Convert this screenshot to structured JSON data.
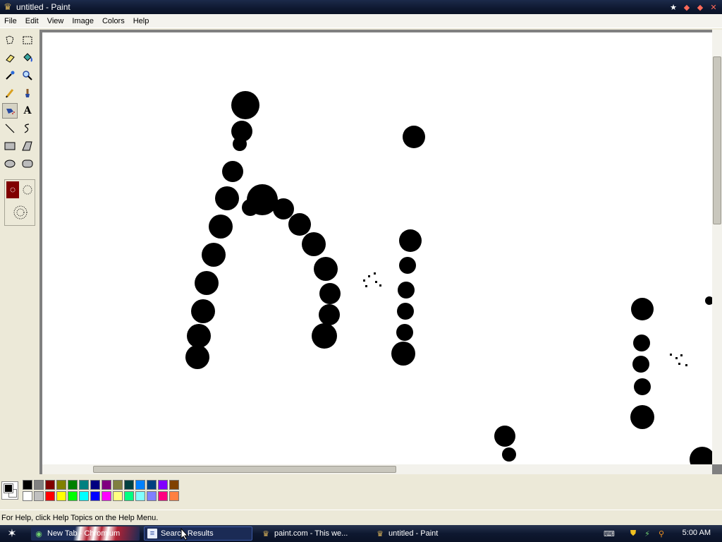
{
  "window": {
    "title": "untitled - Paint"
  },
  "menu": {
    "items": [
      "File",
      "Edit",
      "View",
      "Image",
      "Colors",
      "Help"
    ]
  },
  "tools": [
    {
      "name": "free-form-select",
      "icon": "free-select-icon"
    },
    {
      "name": "select",
      "icon": "rect-select-icon"
    },
    {
      "name": "eraser",
      "icon": "eraser-icon"
    },
    {
      "name": "fill-with-color",
      "icon": "fill-bucket-icon"
    },
    {
      "name": "pick-color",
      "icon": "eyedropper-icon"
    },
    {
      "name": "magnifier",
      "icon": "magnifier-icon"
    },
    {
      "name": "pencil",
      "icon": "pencil-icon"
    },
    {
      "name": "brush",
      "icon": "brush-icon"
    },
    {
      "name": "airbrush",
      "icon": "airbrush-icon",
      "selected": true
    },
    {
      "name": "text",
      "icon": "text-icon",
      "glyph": "A"
    },
    {
      "name": "line",
      "icon": "line-icon"
    },
    {
      "name": "curve",
      "icon": "curve-icon"
    },
    {
      "name": "rectangle",
      "icon": "rectangle-icon"
    },
    {
      "name": "polygon",
      "icon": "polygon-icon"
    },
    {
      "name": "ellipse",
      "icon": "ellipse-icon"
    },
    {
      "name": "rounded-rectangle",
      "icon": "rounded-rect-icon"
    }
  ],
  "palette": {
    "foreground": "#000000",
    "background": "#ffffff",
    "top_row": [
      "#000000",
      "#808080",
      "#800000",
      "#808000",
      "#008000",
      "#008080",
      "#000080",
      "#800080",
      "#808040",
      "#004040",
      "#0080ff",
      "#004080",
      "#8000ff",
      "#804000"
    ],
    "bottom_row": [
      "#ffffff",
      "#c0c0c0",
      "#ff0000",
      "#ffff00",
      "#00ff00",
      "#00ffff",
      "#0000ff",
      "#ff00ff",
      "#ffff80",
      "#00ff80",
      "#80ffff",
      "#8080ff",
      "#ff0080",
      "#ff8040"
    ]
  },
  "status": {
    "text": "For Help, click Help Topics on the Help Menu."
  },
  "taskbar": {
    "tasks": [
      {
        "label": "New Tab - Chromium",
        "icon": "chromium-icon"
      },
      {
        "label": "Search Results",
        "icon": "document-icon"
      },
      {
        "label": "paint.com - This we...",
        "icon": "paint-app-icon"
      },
      {
        "label": "untitled - Paint",
        "icon": "paint-app-icon",
        "active": true
      }
    ],
    "clock": "5:00 AM"
  }
}
